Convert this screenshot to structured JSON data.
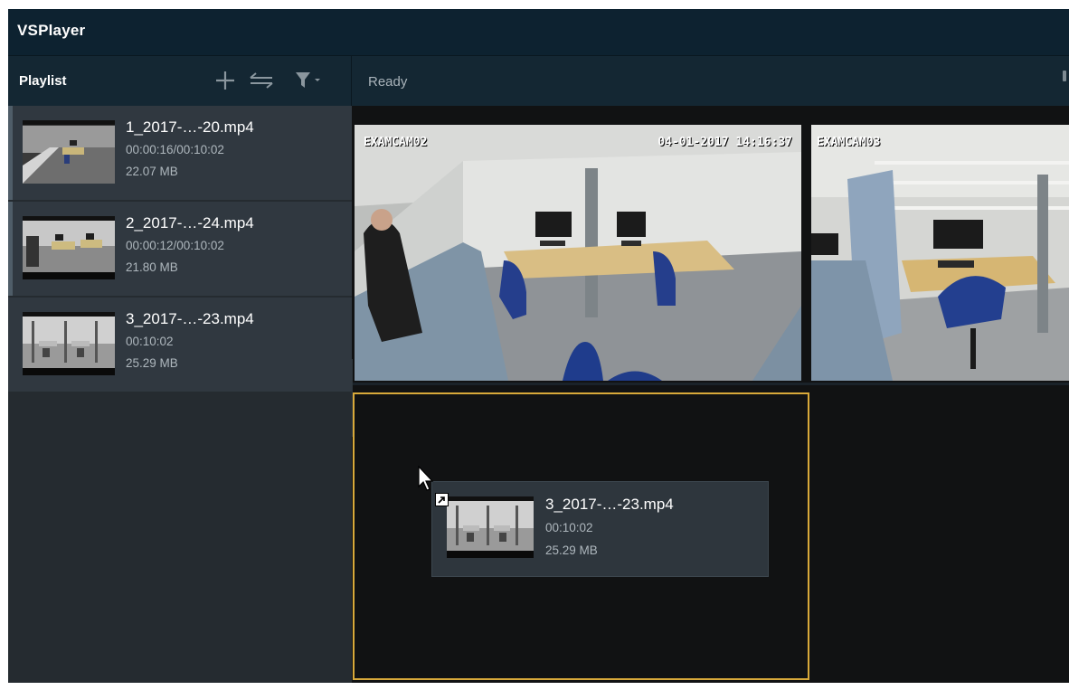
{
  "app": {
    "title": "VSPlayer"
  },
  "header": {
    "playlist_label": "Playlist",
    "status": "Ready"
  },
  "playlist": {
    "items": [
      {
        "name": "1_2017-…-20.mp4",
        "time": "00:00:16/00:10:02",
        "size": "22.07 MB"
      },
      {
        "name": "2_2017-…-24.mp4",
        "time": "00:00:12/00:10:02",
        "size": "21.80 MB"
      },
      {
        "name": "3_2017-…-23.mp4",
        "time": "00:10:02",
        "size": "25.29 MB"
      }
    ]
  },
  "views": [
    {
      "camera": "EXAMCAM02",
      "timestamp": "04-01-2017 14:16:37"
    },
    {
      "camera": "EXAMCAM03"
    }
  ],
  "drag_item": {
    "name": "3_2017-…-23.mp4",
    "time": "00:10:02",
    "size": "25.29 MB"
  },
  "colors": {
    "titlebar": "#0d2230",
    "selection": "#d8a93a",
    "sidebar": "#252b30"
  },
  "icons": [
    "add-icon",
    "sort-icon",
    "filter-icon",
    "chevron-left-icon",
    "cursor-icon",
    "shortcut-arrow-icon"
  ]
}
